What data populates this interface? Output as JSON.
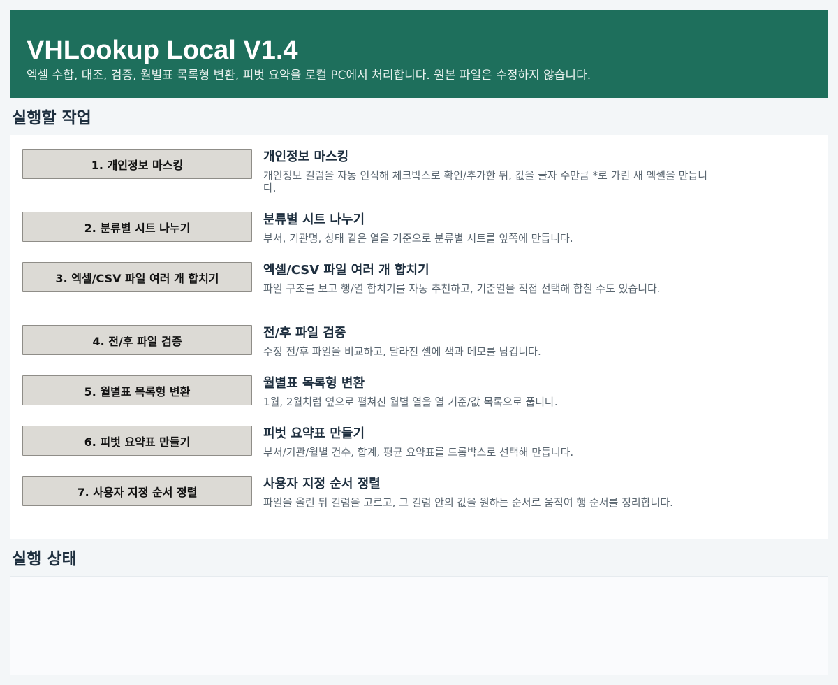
{
  "header": {
    "title": "VHLookup Local V1.4",
    "subtitle": "엑셀 수합, 대조, 검증, 월별표 목록형 변환, 피벗 요약을 로컬 PC에서 처리합니다. 원본 파일은 수정하지 않습니다."
  },
  "sections": {
    "tasks_title": "실행할 작업",
    "status_title": "실행 상태"
  },
  "tasks": [
    {
      "button": "1. 개인정보 마스킹",
      "name": "개인정보 마스킹",
      "desc": "개인정보 컬럼을 자동 인식해 체크박스로 확인/추가한 뒤, 값을 글자 수만큼 *로 가린 새 엑셀을 만듭니다."
    },
    {
      "button": "2. 분류별 시트 나누기",
      "name": "분류별 시트 나누기",
      "desc": "부서, 기관명, 상태 같은 열을 기준으로 분류별 시트를 앞쪽에 만듭니다."
    },
    {
      "button": "3. 엑셀/CSV 파일 여러 개 합치기",
      "name": "엑셀/CSV 파일 여러 개 합치기",
      "desc": "파일 구조를 보고 행/열 합치기를 자동 추천하고, 기준열을 직접 선택해 합칠 수도 있습니다."
    },
    {
      "button": "4. 전/후 파일 검증",
      "name": "전/후 파일 검증",
      "desc": "수정 전/후 파일을 비교하고, 달라진 셀에 색과 메모를 남깁니다."
    },
    {
      "button": "5. 월별표 목록형 변환",
      "name": "월별표 목록형 변환",
      "desc": "1월, 2월처럼 옆으로 펼쳐진 월별 열을 열 기준/값 목록으로 풉니다."
    },
    {
      "button": "6. 피벗 요약표 만들기",
      "name": "피벗 요약표 만들기",
      "desc": "부서/기관/월별 건수, 합계, 평균 요약표를 드롭박스로 선택해 만듭니다."
    },
    {
      "button": "7. 사용자 지정 순서 정렬",
      "name": "사용자 지정 순서 정렬",
      "desc": "파일을 올린 뒤 컬럼을 고르고, 그 컬럼 안의 값을 원하는 순서로 움직여 행 순서를 정리합니다."
    }
  ],
  "colors": {
    "header_bg": "#1e6f5c",
    "button_bg": "#dcdad5",
    "heading_text": "#1e2f3f"
  }
}
